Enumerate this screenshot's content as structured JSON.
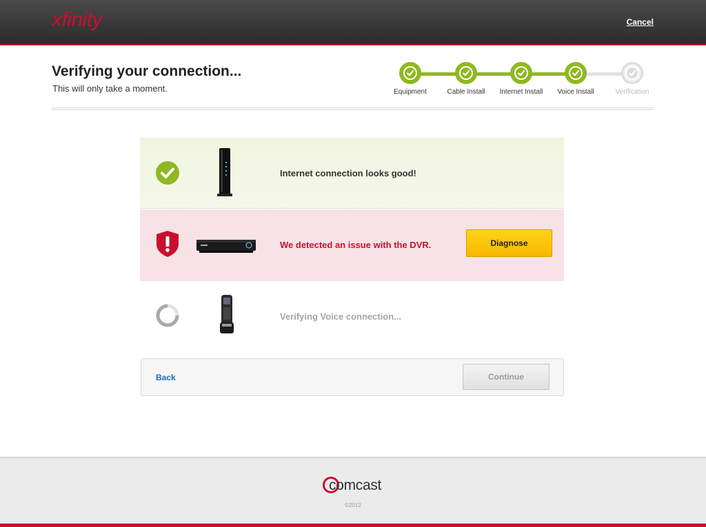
{
  "header": {
    "brand": "xfinity",
    "cancel_label": "Cancel"
  },
  "page": {
    "title": "Verifying your connection...",
    "subtitle": "This will only take a moment."
  },
  "steps": [
    {
      "label": "Equipment",
      "status": "complete"
    },
    {
      "label": "Cable Install",
      "status": "complete"
    },
    {
      "label": "Internet Install",
      "status": "complete"
    },
    {
      "label": "Voice Install",
      "status": "complete"
    },
    {
      "label": "Verification",
      "status": "pending"
    }
  ],
  "checks": {
    "internet": {
      "message": "Internet connection looks good!",
      "status": "success",
      "device": "modem"
    },
    "dvr": {
      "message": "We detected an issue with the DVR.",
      "status": "error",
      "device": "dvr",
      "action_label": "Diagnose"
    },
    "voice": {
      "message": "Verifying Voice connection...",
      "status": "in-progress",
      "device": "cordless-phone"
    }
  },
  "nav": {
    "back_label": "Back",
    "continue_label": "Continue"
  },
  "footer": {
    "brand": "comcast",
    "copyright": "©2012"
  },
  "colors": {
    "brand_red": "#c8102e",
    "success_green": "#8fb821",
    "button_yellow": "#ffc000",
    "link_blue": "#1a6dc0"
  }
}
